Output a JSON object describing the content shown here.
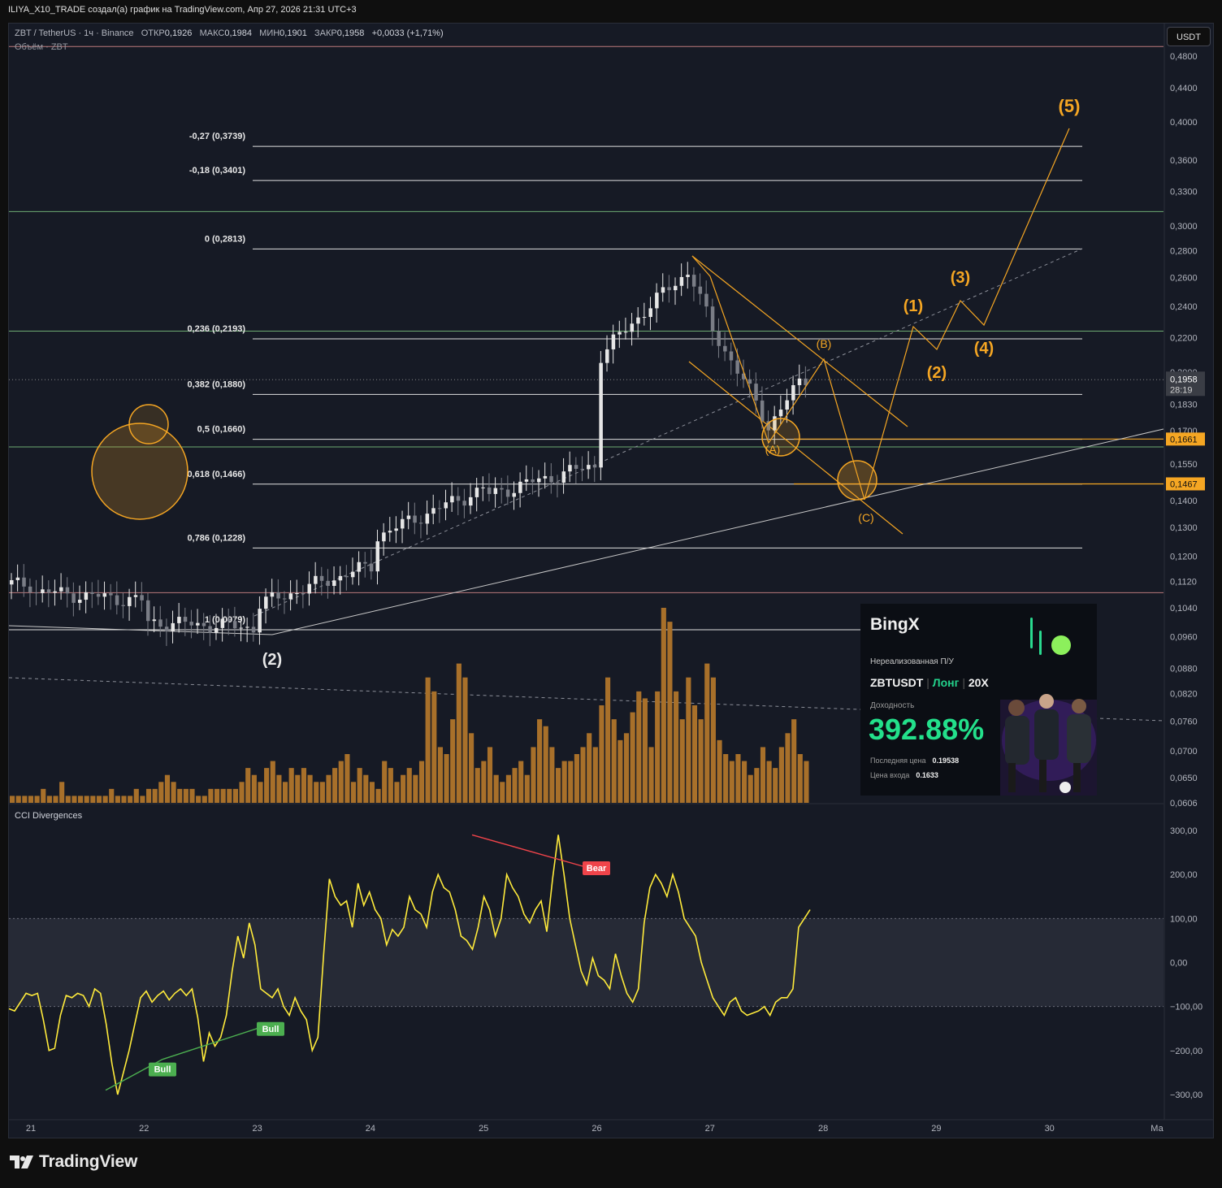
{
  "header": {
    "caption": "ILIYA_X10_TRADE создал(а) график на TradingView.com, Апр 27, 2026 21:31 UTC+3"
  },
  "legend": {
    "symbol": "ZBT / TetherUS · 1ч · Binance",
    "open_label": "ОТКР",
    "open": "0,1926",
    "high_label": "МАКС",
    "high": "0,1984",
    "low_label": "МИН",
    "low": "0,1901",
    "close_label": "ЗАКР",
    "close": "0,1958",
    "change": "+0,0033 (+1,71%)",
    "volume_title": "Объём · ZBT"
  },
  "currency_button": "USDT",
  "indicator_title": "CCI Divergences",
  "footer": {
    "brand": "TradingView"
  },
  "colors": {
    "background": "#161a25",
    "fib_line": "#e0e0e0",
    "green_level": "#7bc47f",
    "red_level": "#d98a8a",
    "orange": "#f5a623",
    "volume": "#a8702a",
    "cci": "#ffeb3b",
    "bull": "#4caf50",
    "bear": "#f0444a"
  },
  "chart_data": [
    {
      "type": "candlestick",
      "title": "ZBT / TetherUS · 1ч · Binance",
      "price_axis": {
        "scale": "log",
        "ticks": [
          "0,4800",
          "0,4400",
          "0,4000",
          "0,3600",
          "0,3300",
          "0,3000",
          "0,2800",
          "0,2600",
          "0,2400",
          "0,2200",
          "0,2000",
          "0,1830",
          "0,1700",
          "0,1550",
          "0,1400",
          "0,1300",
          "0,1200",
          "0,1120",
          "0,1040",
          "0,0960",
          "0,0880",
          "0,0820",
          "0,0760",
          "0,0700",
          "0,0650",
          "0,0606"
        ],
        "tick_values": [
          0.48,
          0.44,
          0.4,
          0.36,
          0.33,
          0.3,
          0.28,
          0.26,
          0.24,
          0.22,
          0.2,
          0.183,
          0.17,
          0.155,
          0.14,
          0.13,
          0.12,
          0.112,
          0.104,
          0.096,
          0.088,
          0.082,
          0.076,
          0.07,
          0.065,
          0.0606
        ],
        "ylim": [
          0.0606,
          0.49
        ]
      },
      "time_axis": {
        "labels": [
          "21",
          "22",
          "23",
          "24",
          "25",
          "26",
          "27",
          "28",
          "29",
          "30",
          "Ма"
        ]
      },
      "last_price": {
        "value": "0,1958",
        "countdown": "28:19"
      },
      "price_labels": [
        {
          "value": "0,1661",
          "style": "orange"
        },
        {
          "value": "0,1467",
          "style": "orange"
        }
      ],
      "fib_levels": [
        {
          "label": "-0,27 (0,3739)",
          "price": 0.3739
        },
        {
          "label": "-0,18 (0,3401)",
          "price": 0.3401
        },
        {
          "label": "0 (0,2813)",
          "price": 0.2813
        },
        {
          "label": "0,236 (0,2193)",
          "price": 0.2193
        },
        {
          "label": "0,382 (0,1880)",
          "price": 0.188
        },
        {
          "label": "0,5 (0,1660)",
          "price": 0.166
        },
        {
          "label": "0,618 (0,1466)",
          "price": 0.1466
        },
        {
          "label": "0,786 (0,1228)",
          "price": 0.1228
        },
        {
          "label": "1 (0,0979)",
          "price": 0.0979
        }
      ],
      "horizontal_levels": [
        {
          "price": 0.493,
          "style": "red"
        },
        {
          "price": 0.312,
          "style": "green"
        },
        {
          "price": 0.224,
          "style": "green"
        },
        {
          "price": 0.1625,
          "style": "green"
        },
        {
          "price": 0.1085,
          "style": "red"
        }
      ],
      "price_path": [
        [
          "21",
          0.111
        ],
        [
          "21",
          0.109
        ],
        [
          "22",
          0.106
        ],
        [
          "22",
          0.1
        ],
        [
          "23",
          0.0985
        ],
        [
          "23",
          0.105
        ],
        [
          "24",
          0.117
        ],
        [
          "24",
          0.126
        ],
        [
          "25",
          0.145
        ],
        [
          "25",
          0.142
        ],
        [
          "26",
          0.155
        ],
        [
          "26",
          0.208
        ],
        [
          "26.8",
          0.265
        ],
        [
          "27",
          0.225
        ],
        [
          "27.5",
          0.172
        ],
        [
          "27.8",
          0.1958
        ]
      ],
      "wave_projection": [
        {
          "label": "(B)",
          "price": 0.206
        },
        {
          "label": "(C)",
          "price": 0.14
        },
        {
          "label": "(1)",
          "price": 0.224
        },
        {
          "label": "(2)",
          "price": 0.21
        },
        {
          "label": "(3)",
          "price": 0.243
        },
        {
          "label": "(4)",
          "price": 0.224
        },
        {
          "label": "(5)",
          "price": 0.4
        }
      ],
      "annotations": [
        "(A)",
        "(B)",
        "(C)",
        "(1)",
        "(2)",
        "(3)",
        "(4)",
        "(5)",
        "(2)"
      ]
    },
    {
      "type": "bar",
      "title": "Объём · ZBT",
      "series": [
        {
          "name": "Объём · ZBT",
          "values": [
            1,
            1,
            1,
            1,
            1,
            2,
            1,
            1,
            3,
            1,
            1,
            1,
            1,
            1,
            1,
            1,
            2,
            1,
            1,
            1,
            2,
            1,
            2,
            2,
            3,
            4,
            3,
            2,
            2,
            2,
            1,
            1,
            2,
            2,
            2,
            2,
            2,
            3,
            5,
            4,
            3,
            5,
            6,
            4,
            3,
            5,
            4,
            5,
            4,
            3,
            3,
            4,
            5,
            6,
            7,
            3,
            5,
            4,
            3,
            2,
            6,
            5,
            3,
            4,
            5,
            4,
            6,
            18,
            16,
            8,
            7,
            12,
            20,
            18,
            10,
            5,
            6,
            8,
            4,
            3,
            4,
            5,
            6,
            4,
            8,
            12,
            11,
            8,
            5,
            6,
            6,
            7,
            8,
            10,
            8,
            14,
            18,
            12,
            9,
            10,
            13,
            16,
            15,
            8,
            16,
            28,
            26,
            16,
            12,
            18,
            14,
            12,
            20,
            18,
            9,
            7,
            6,
            7,
            6,
            4,
            5,
            8,
            6,
            5,
            8,
            10,
            12,
            7,
            6
          ]
        }
      ]
    },
    {
      "type": "line",
      "title": "CCI Divergences",
      "y_ticks": [
        "300,00",
        "200,00",
        "100,00",
        "0,00",
        "−100,00",
        "−200,00",
        "−300,00"
      ],
      "ylim": [
        -300,
        300
      ],
      "band": [
        -100,
        100
      ],
      "series": [
        {
          "values": [
            -105,
            -110,
            -90,
            -70,
            -75,
            -70,
            -130,
            -200,
            -195,
            -120,
            -75,
            -80,
            -70,
            -75,
            -100,
            -60,
            -70,
            -140,
            -230,
            -300,
            -250,
            -200,
            -140,
            -80,
            -65,
            -90,
            -75,
            -65,
            -85,
            -70,
            -60,
            -75,
            -60,
            -125,
            -225,
            -160,
            -190,
            -170,
            -120,
            -20,
            60,
            10,
            90,
            40,
            -60,
            -70,
            -80,
            -60,
            -100,
            -120,
            -80,
            -110,
            -130,
            -200,
            -170,
            20,
            190,
            150,
            130,
            140,
            80,
            180,
            130,
            160,
            120,
            100,
            40,
            75,
            60,
            80,
            150,
            120,
            110,
            80,
            160,
            200,
            170,
            160,
            120,
            60,
            50,
            30,
            80,
            150,
            120,
            60,
            100,
            200,
            170,
            150,
            110,
            90,
            120,
            140,
            70,
            190,
            290,
            200,
            100,
            40,
            -20,
            -50,
            10,
            -30,
            -40,
            -60,
            20,
            -30,
            -70,
            -90,
            -60,
            90,
            170,
            200,
            180,
            150,
            200,
            160,
            100,
            80,
            60,
            0,
            -40,
            -80,
            -100,
            -120,
            -90,
            -80,
            -110,
            -120,
            -115,
            -110,
            -100,
            -120,
            -90,
            -80,
            -80,
            -60,
            80,
            100,
            120
          ]
        }
      ],
      "divergences": [
        {
          "type": "Bull",
          "label": "Bull"
        },
        {
          "type": "Bull",
          "label": "Bull"
        },
        {
          "type": "Bear",
          "label": "Bear"
        }
      ]
    }
  ],
  "promo_card": {
    "brand": "BingX",
    "subtitle": "Нереализованная П/У",
    "pair": "ZBTUSDT",
    "side": "Лонг",
    "leverage": "20X",
    "yield_label": "Доходность",
    "yield": "392.88%",
    "last_price_label": "Последняя цена",
    "last_price": "0.19538",
    "entry_price_label": "Цена входа",
    "entry_price": "0.1633"
  }
}
